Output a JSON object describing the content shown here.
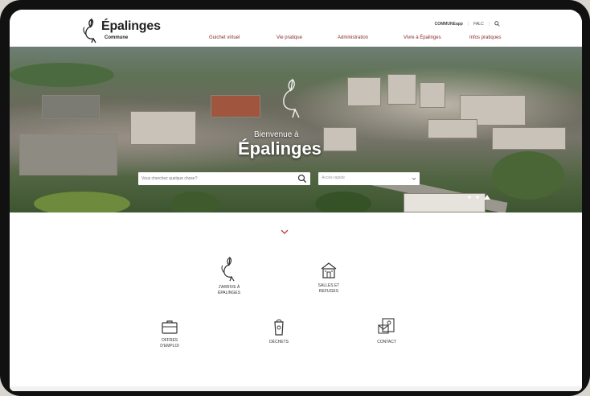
{
  "brand": {
    "title": "Épalinges",
    "subtitle": "Commune"
  },
  "topbar": {
    "app": "COMMUNEapp",
    "kiosk": "FALC",
    "separator": "|"
  },
  "nav": [
    {
      "label": "Guichet virtuel"
    },
    {
      "label": "Vie pratique"
    },
    {
      "label": "Administration"
    },
    {
      "label": "Vivre à Épalinges"
    },
    {
      "label": "Infos pratiques"
    }
  ],
  "hero": {
    "greeting": "Bienvenue à",
    "title": "Épalinges",
    "search_placeholder": "Vous cherchez quelque chose?",
    "select_placeholder": "Accès rapide"
  },
  "tiles": [
    {
      "label_line1": "J'arrive à",
      "label_line2": "Épalinges",
      "icon": "bird-icon"
    },
    {
      "label_line1": "Salles et",
      "label_line2": "refuges",
      "icon": "building-icon"
    },
    {
      "label_line1": "Offres",
      "label_line2": "d'emploi",
      "icon": "briefcase-icon"
    },
    {
      "label_line1": "Déchets",
      "label_line2": "",
      "icon": "trash-icon"
    },
    {
      "label_line1": "Contact",
      "label_line2": "",
      "icon": "contact-icon"
    }
  ],
  "colors": {
    "accent": "#c23b3b",
    "nav_text": "#8a2a2a",
    "icon_stroke": "#333333"
  }
}
